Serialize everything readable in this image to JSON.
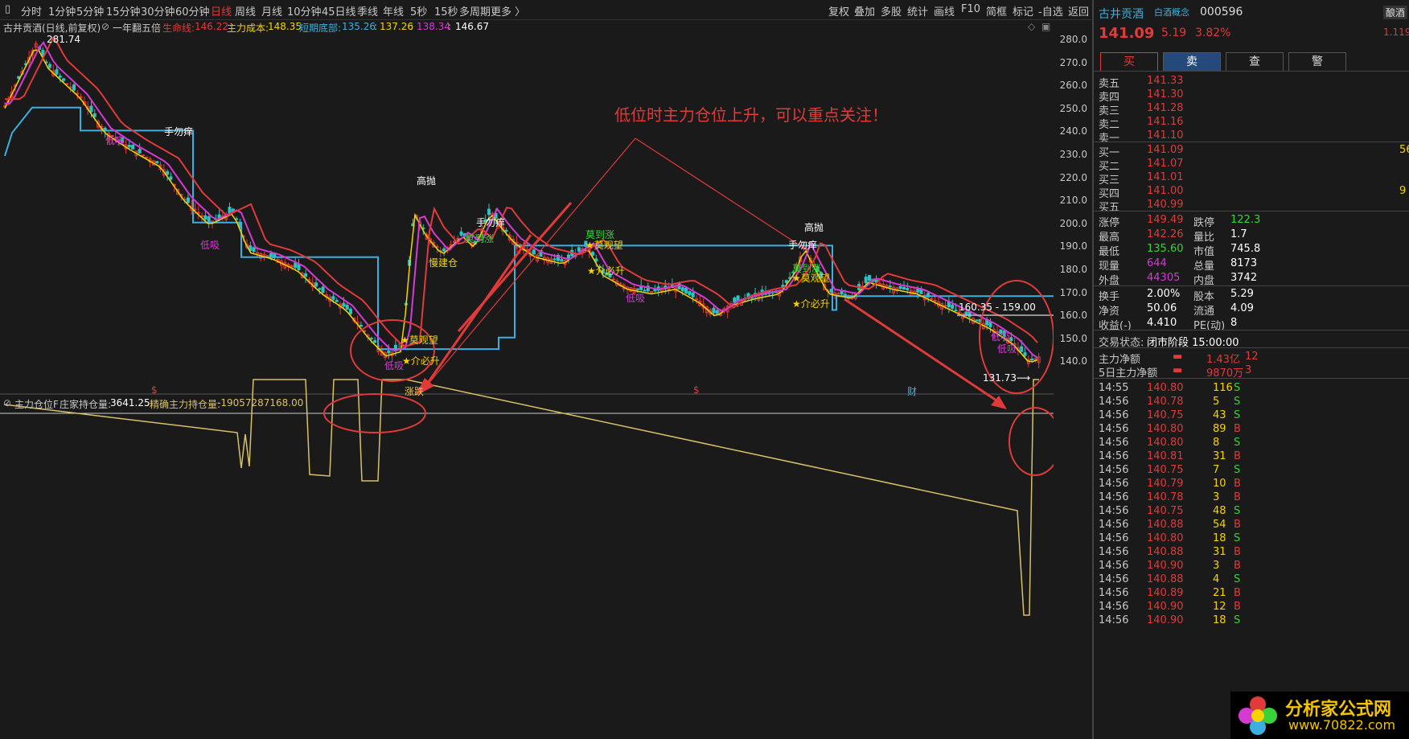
{
  "toolbar": {
    "left_items": [
      "分时",
      "1分钟",
      "5分钟",
      "15分钟",
      "30分钟",
      "60分钟",
      "日线",
      "周线",
      "月线",
      "10分钟",
      "45日线",
      "季线",
      "年线",
      "5秒",
      "15秒",
      "多周期",
      "更多 〉"
    ],
    "active_item": "日线",
    "right_items": [
      "复权",
      "叠加",
      "多股",
      "统计",
      "画线",
      "F10",
      "简框",
      "标记",
      "-自选",
      "返回"
    ]
  },
  "info": {
    "title": "古井贡酒(日线,前复权)",
    "indicator": "一年翻五倍",
    "life_line_label": "生命线:",
    "life_line_value": "146.22",
    "cost_label": "主力成本:",
    "cost_value": "148.35",
    "bottom_label": "短期底部:",
    "bottom_values": [
      "135.26",
      "137.26",
      "138.34",
      "146.67"
    ]
  },
  "y_axis": [
    "280.0",
    "270.0",
    "260.0",
    "250.0",
    "240.0",
    "230.0",
    "220.0",
    "210.0",
    "200.0",
    "190.0",
    "180.0",
    "170.0",
    "160.0",
    "150.0",
    "140.0"
  ],
  "chart_labels": {
    "high_price": "281.74",
    "low_price": "131.73⟶",
    "range_label": "160.35 - 159.00",
    "marks": [
      "手勿痒",
      "低吸",
      "低吸",
      "高抛",
      "慢建仓",
      "手勿痒",
      "莫到涨",
      "莫到涨",
      "★莫观望",
      "★介必升",
      "低吸",
      "高抛",
      "手勿痒",
      "莫到涨",
      "★莫观望",
      "★介必升",
      "低吸",
      "★莫观望",
      "★介必升",
      "低吸",
      "低吸"
    ],
    "bottom_markers": [
      "$",
      "涨跌",
      "$",
      "财"
    ]
  },
  "annotation": "低位时主力仓位上升，可以重点关注！",
  "indicator_bar": {
    "name": "主力仓位F",
    "holding_label": "庄家持仓量:",
    "holding_value": "3641.25",
    "precise_label": "精确主力持仓量:",
    "precise_value": "-19057287168.00"
  },
  "right_panel": {
    "stock_name": "古井贡酒",
    "concept": "白酒概念",
    "code": "000596",
    "tag": "酿酒",
    "price": "141.09",
    "change": "5.19",
    "change_pct": "3.82%",
    "extra": "1.119",
    "buttons": [
      "买",
      "卖",
      "查",
      "警"
    ],
    "sell_orders": [
      {
        "label": "卖五",
        "price": "141.33"
      },
      {
        "label": "卖四",
        "price": "141.30"
      },
      {
        "label": "卖三",
        "price": "141.28"
      },
      {
        "label": "卖二",
        "price": "141.16"
      },
      {
        "label": "卖一",
        "price": "141.10"
      }
    ],
    "buy_orders": [
      {
        "label": "买一",
        "price": "141.09",
        "vol": "56"
      },
      {
        "label": "买二",
        "price": "141.07",
        "vol": ""
      },
      {
        "label": "买三",
        "price": "141.01",
        "vol": ""
      },
      {
        "label": "买四",
        "price": "141.00",
        "vol": "9"
      },
      {
        "label": "买五",
        "price": "140.99",
        "vol": ""
      }
    ],
    "stats": [
      {
        "l1": "涨停",
        "v1": "149.49",
        "l2": "跌停",
        "v2": "122.3"
      },
      {
        "l1": "最高",
        "v1": "142.26",
        "l2": "量比",
        "v2": "1.7"
      },
      {
        "l1": "最低",
        "v1": "135.60",
        "l2": "市值",
        "v2": "745.8"
      },
      {
        "l1": "现量",
        "v1": "644",
        "l2": "总量",
        "v2": "8173"
      },
      {
        "l1": "外盘",
        "v1": "44305",
        "l2": "内盘",
        "v2": "3742"
      }
    ],
    "stats2": [
      {
        "l1": "换手",
        "v1": "2.00%",
        "l2": "股本",
        "v2": "5.29"
      },
      {
        "l1": "净资",
        "v1": "50.06",
        "l2": "流通",
        "v2": "4.09"
      },
      {
        "l1": "收益(-)",
        "v1": "4.410",
        "l2": "PE(动)",
        "v2": "8"
      }
    ],
    "trade_status_label": "交易状态:",
    "trade_status": "闭市阶段 15:00:00",
    "net_main_label": "主力净额",
    "net_main_value": "1.43亿",
    "net_main_extra": "12",
    "net5_label": "5日主力净额",
    "net5_value": "9870万",
    "net5_extra": "3",
    "ticks": [
      {
        "t": "14:55",
        "p": "140.80",
        "v": "116",
        "s": "S"
      },
      {
        "t": "14:56",
        "p": "140.78",
        "v": "5",
        "s": "S"
      },
      {
        "t": "14:56",
        "p": "140.75",
        "v": "43",
        "s": "S"
      },
      {
        "t": "14:56",
        "p": "140.80",
        "v": "89",
        "s": "B"
      },
      {
        "t": "14:56",
        "p": "140.80",
        "v": "8",
        "s": "S"
      },
      {
        "t": "14:56",
        "p": "140.81",
        "v": "31",
        "s": "B"
      },
      {
        "t": "14:56",
        "p": "140.75",
        "v": "7",
        "s": "S"
      },
      {
        "t": "14:56",
        "p": "140.79",
        "v": "10",
        "s": "B"
      },
      {
        "t": "14:56",
        "p": "140.78",
        "v": "3",
        "s": "B"
      },
      {
        "t": "14:56",
        "p": "140.75",
        "v": "48",
        "s": "S"
      },
      {
        "t": "14:56",
        "p": "140.88",
        "v": "54",
        "s": "B"
      },
      {
        "t": "14:56",
        "p": "140.80",
        "v": "18",
        "s": "S"
      },
      {
        "t": "14:56",
        "p": "140.88",
        "v": "31",
        "s": "B"
      },
      {
        "t": "14:56",
        "p": "140.90",
        "v": "3",
        "s": "B"
      },
      {
        "t": "14:56",
        "p": "140.88",
        "v": "4",
        "s": "S"
      },
      {
        "t": "14:56",
        "p": "140.89",
        "v": "21",
        "s": "B"
      },
      {
        "t": "14:56",
        "p": "140.90",
        "v": "12",
        "s": "B"
      },
      {
        "t": "14:56",
        "p": "140.90",
        "v": "18",
        "s": "S"
      }
    ]
  },
  "logo": {
    "name": "分析家公式网",
    "url": "www.70822.com"
  },
  "colors": {
    "up": "#e03a3a",
    "down": "#2ec3c3",
    "ma_red": "#e03a3a",
    "ma_magenta": "#d33bd3",
    "ma_yellow": "#f5d400",
    "support": "#3bb0e0",
    "indicator": "#d8c06a"
  }
}
